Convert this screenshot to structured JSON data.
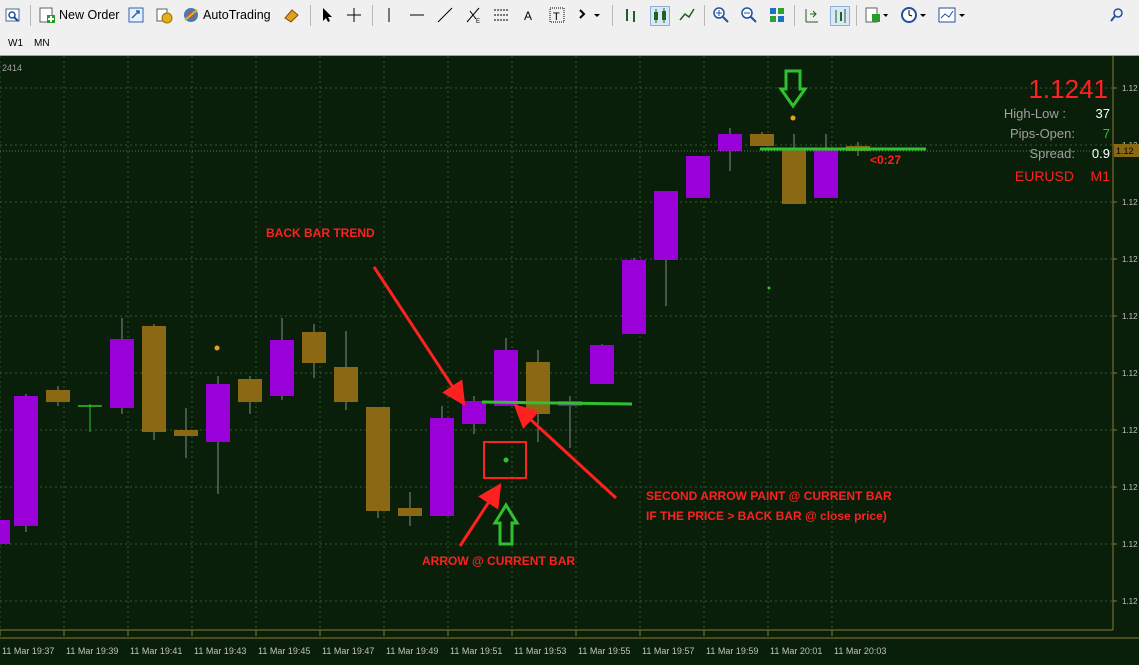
{
  "toolbar": {
    "new_order_label": "New Order",
    "autotrading_label": "AutoTrading",
    "icons": [
      "chart-zoom-icon",
      "new-order-icon",
      "sync-icon",
      "coins-icon",
      "autotrading-icon",
      "eraser-icon",
      "cursor-icon",
      "crosshair-icon",
      "vertical-line-icon",
      "horizontal-line-icon",
      "trendline-icon",
      "fibonacci-icon",
      "channel-icon",
      "text-icon",
      "label-icon",
      "arrows-icon",
      "bar-chart-icon",
      "candlestick-icon",
      "line-chart-icon",
      "zoom-in-icon",
      "zoom-out-icon",
      "tile-windows-icon",
      "chart-shift-icon",
      "autoscroll-icon",
      "indicators-icon",
      "periods-icon",
      "templates-icon",
      "search-icon"
    ]
  },
  "timeframes": [
    "W1",
    "MN"
  ],
  "chart": {
    "corner_label": "2414",
    "price": "1.1241",
    "high_low_label": "High-Low :",
    "high_low_value": "37",
    "pips_open_label": "Pips-Open:",
    "pips_open_value": "7",
    "spread_label": "Spread:",
    "spread_value": "0.9",
    "symbol": "EURUSD",
    "timeframe": "M1",
    "timer": "<0:27",
    "price_tag": "1.12",
    "annotations": {
      "back_bar_trend": "BACK BAR TREND",
      "second_arrow_line1": "SECOND ARROW  PAINT @ CURRENT BAR",
      "second_arrow_line2": "IF THE PRICE > BACK BAR @ close price)",
      "arrow_current_bar": "ARROW @ CURRENT BAR"
    },
    "colors": {
      "background": "#0a1f0a",
      "grid": "#2e5a2e",
      "bull": "#9a00d8",
      "bear": "#8b6914",
      "annotation": "#ff2020",
      "green_arrow": "#30c030",
      "trend_line": "#30c030"
    }
  },
  "chart_data": {
    "type": "candlestick",
    "y_tick_labels": [
      "1.12",
      "1.12",
      "1.12",
      "1.12",
      "1.12",
      "1.12",
      "1.12",
      "1.12",
      "1.12",
      "1.12"
    ],
    "x_tick_labels": [
      "11 Mar 19:37",
      "11 Mar 19:39",
      "11 Mar 19:41",
      "11 Mar 19:43",
      "11 Mar 19:45",
      "11 Mar 19:47",
      "11 Mar 19:49",
      "11 Mar 19:51",
      "11 Mar 19:53",
      "11 Mar 19:55",
      "11 Mar 19:57",
      "11 Mar 19:59",
      "11 Mar 20:01",
      "11 Mar 20:03"
    ],
    "grid": true
  }
}
